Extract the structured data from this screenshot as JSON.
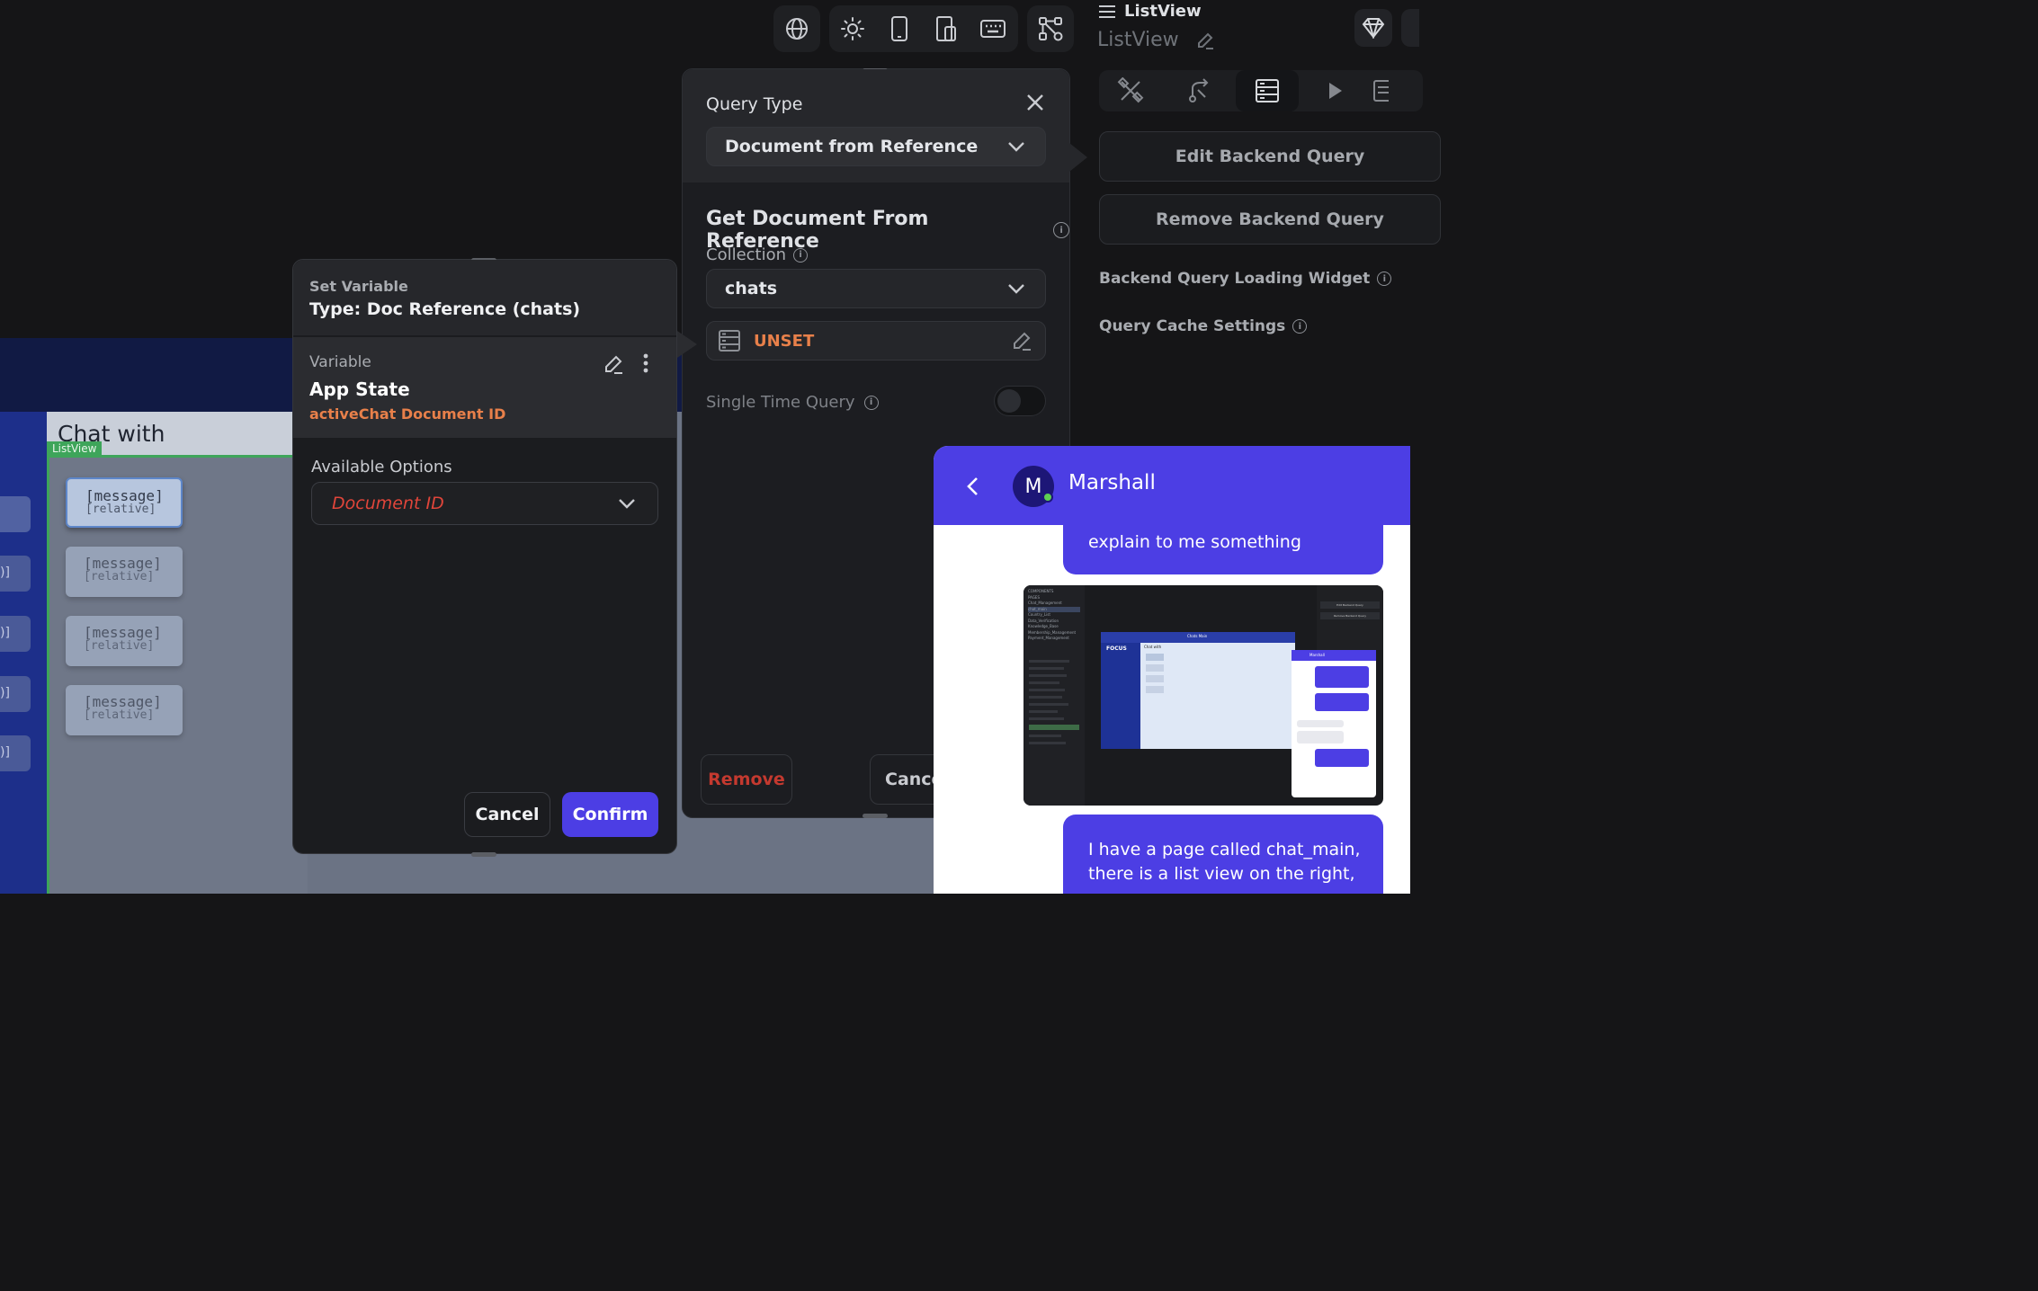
{
  "toolbar": {
    "icons": [
      "globe-icon",
      "sun-icon",
      "phone-icon",
      "tablet-icon",
      "keyboard-icon",
      "connections-icon"
    ]
  },
  "properties_panel": {
    "header_title": "ListView",
    "widget_name": "ListView",
    "edit_backend_query": "Edit Backend Query",
    "remove_backend_query": "Remove Backend Query",
    "loading_widget_label": "Backend Query Loading Widget",
    "cache_settings_label": "Query Cache Settings"
  },
  "canvas": {
    "page_title": "Chat with",
    "listview_tag": "ListView",
    "messages": [
      {
        "text": "[message]",
        "sub": "[relative]"
      },
      {
        "text": "[message]",
        "sub": "[relative]"
      },
      {
        "text": "[message]",
        "sub": "[relative]"
      },
      {
        "text": "[message]",
        "sub": "[relative]"
      }
    ],
    "left_fragments": [
      ")]",
      ")]",
      ")]",
      ")]"
    ]
  },
  "query_panel": {
    "query_type_label": "Query Type",
    "query_type_value": "Document from Reference",
    "section_title": "Get Document From Reference",
    "collection_label": "Collection",
    "collection_value": "chats",
    "reference_value": "UNSET",
    "single_time_label": "Single Time Query",
    "remove_label": "Remove",
    "cancel_label": "Cancel"
  },
  "set_variable": {
    "title": "Set Variable",
    "type_label": "Type: Doc Reference (chats)",
    "variable_label": "Variable",
    "variable_source": "App State",
    "variable_field": "activeChat Document ID",
    "options_label": "Available Options",
    "options_value": "Document ID",
    "cancel_label": "Cancel",
    "confirm_label": "Confirm"
  },
  "chat": {
    "avatar_letter": "M",
    "name": "Marshall",
    "partial_message": "explain to me something",
    "message_bottom_line1": "I have a page called chat_main,",
    "message_bottom_line2": "there is a list view on the right,",
    "thumbnail": {
      "logo": "FOCUS",
      "center_title": "Chats Main",
      "page_title": "Chat with",
      "contact": "Marshall",
      "right_edit": "Edit Backend Query",
      "right_remove": "Remove Backend Query",
      "left_items": [
        "COMPONENTS",
        "PAGES",
        "Chat_Management",
        "chat_main",
        "Country_List",
        "Data_Verification",
        "Knowledge_Base",
        "Membership_Management",
        "Payment_Management"
      ]
    }
  },
  "colors": {
    "accent": "#4c3ee4",
    "warning": "#e8804a",
    "danger": "#e0453a",
    "online": "#5ecf52"
  }
}
